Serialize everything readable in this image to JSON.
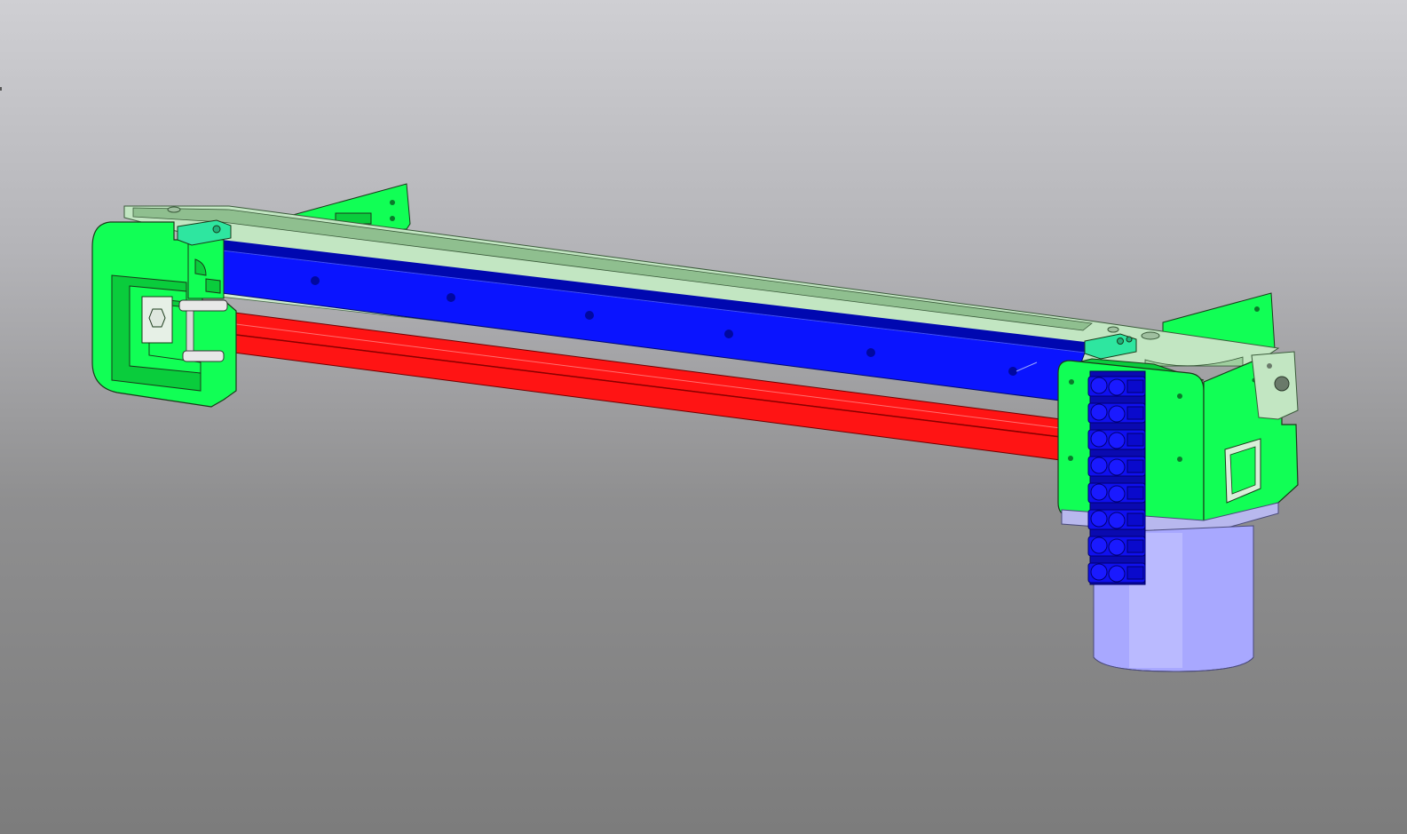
{
  "viewport": {
    "background": {
      "top": "#cfcfd3",
      "bottom": "#7c7c7c"
    }
  },
  "model": {
    "colors": {
      "frame_green": "#11ff55",
      "frame_green_dark": "#0acc3c",
      "frame_outline": "#1a3a1a",
      "plate_light_green": "#c2e6c2",
      "plate_shadow": "#8fbf8f",
      "blue_rail": "#0a14ff",
      "blue_rail_dark": "#0008b0",
      "red_rod": "#ff1414",
      "red_rod_dark": "#b00000",
      "motor_lavender": "#a8a8ff",
      "motor_flange": "#b8b8ee",
      "terminal_blue": "#1010ee",
      "clamp_teal": "#2ee6a0"
    },
    "parts": [
      {
        "name": "left-bracket",
        "color_key": "frame_green"
      },
      {
        "name": "right-motor-mount",
        "color_key": "frame_green"
      },
      {
        "name": "top-plate",
        "color_key": "plate_light_green"
      },
      {
        "name": "linear-rail",
        "color_key": "blue_rail"
      },
      {
        "name": "guide-rod",
        "color_key": "red_rod"
      },
      {
        "name": "stepper-motor",
        "color_key": "motor_lavender"
      },
      {
        "name": "terminal-block",
        "color_key": "terminal_blue"
      },
      {
        "name": "rail-clamp",
        "color_key": "clamp_teal"
      }
    ]
  }
}
